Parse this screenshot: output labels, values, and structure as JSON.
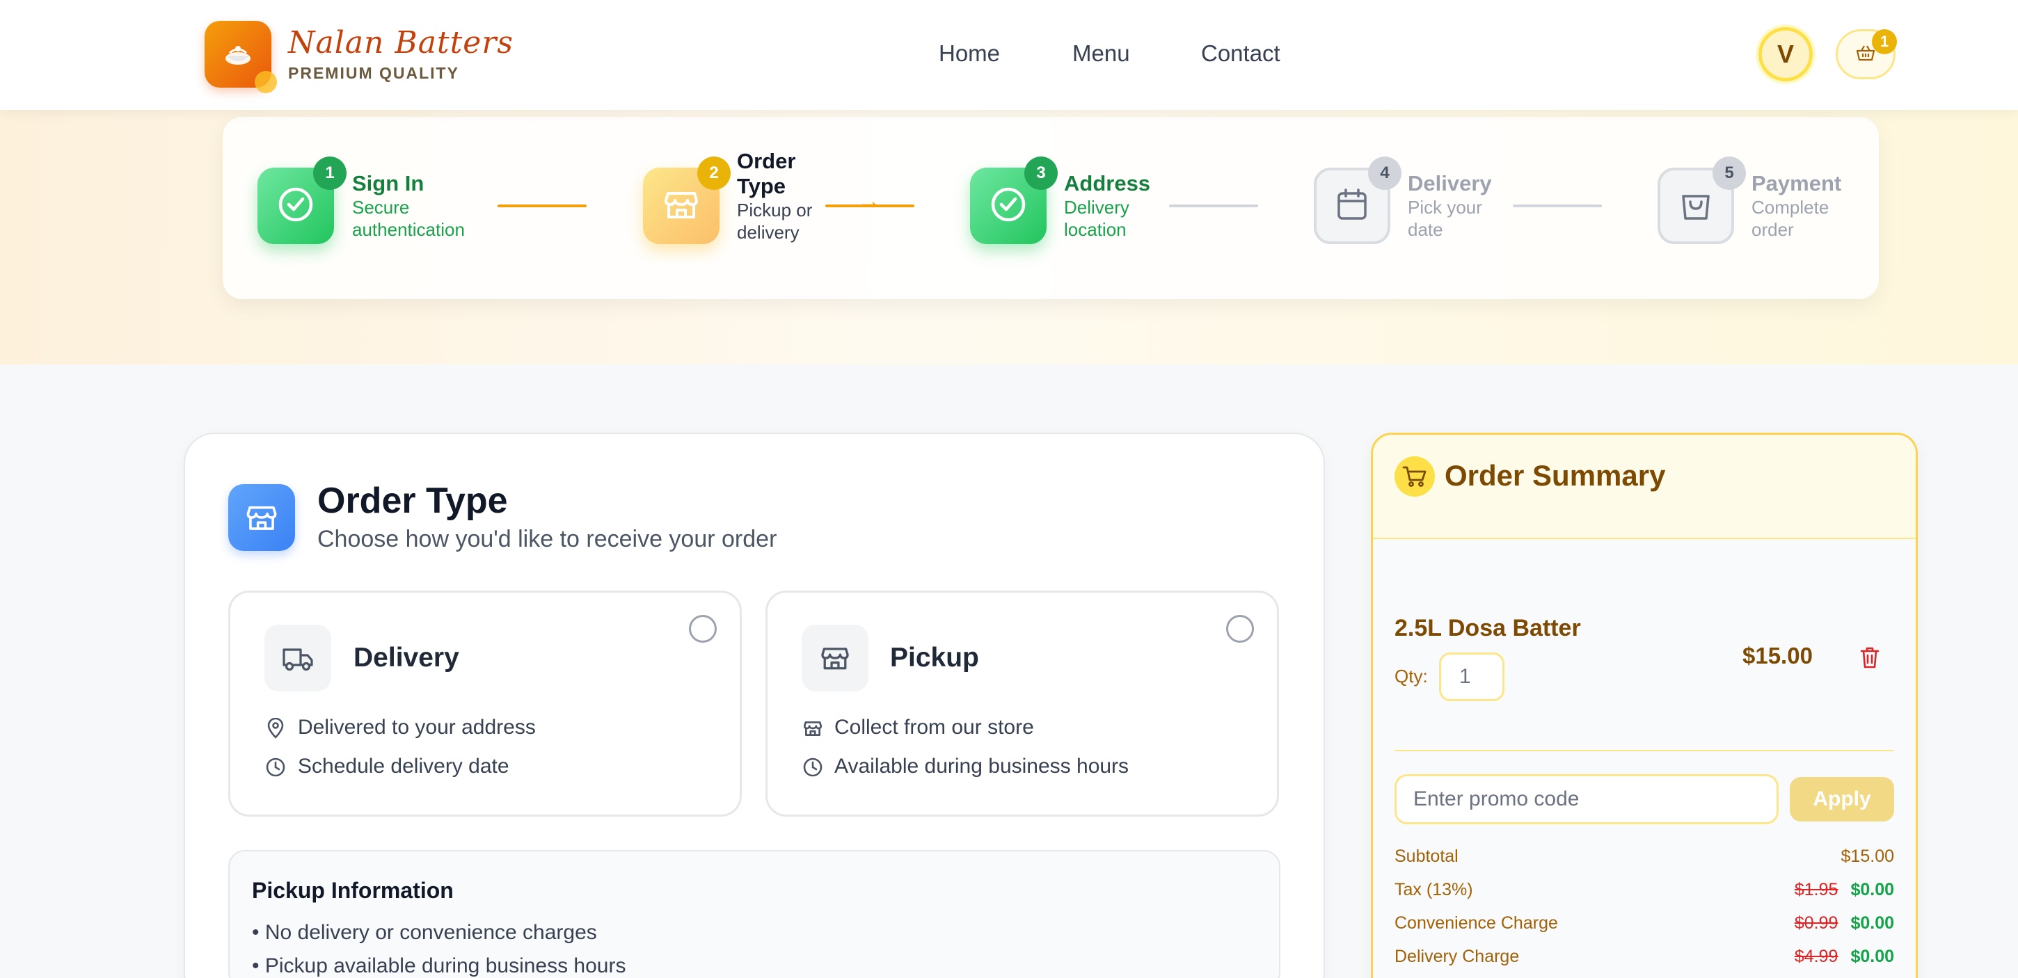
{
  "brand": {
    "name": "Nalan Batters",
    "tagline": "PREMIUM QUALITY"
  },
  "nav": {
    "home": "Home",
    "menu": "Menu",
    "contact": "Contact"
  },
  "user": {
    "initial": "V"
  },
  "cart": {
    "count": "1"
  },
  "steps": [
    {
      "num": "1",
      "title": "Sign In",
      "desc": "Secure authentication",
      "status": "completed",
      "icon": "check-circle-icon"
    },
    {
      "num": "2",
      "title": "Order Type",
      "desc": "Pickup or delivery",
      "status": "active",
      "icon": "store-icon"
    },
    {
      "num": "3",
      "title": "Address",
      "desc": "Delivery location",
      "status": "completed",
      "icon": "check-circle-icon"
    },
    {
      "num": "4",
      "title": "Delivery",
      "desc": "Pick your date",
      "status": "pending",
      "icon": "calendar-icon"
    },
    {
      "num": "5",
      "title": "Payment",
      "desc": "Complete order",
      "status": "pending",
      "icon": "shopping-bag-icon"
    }
  ],
  "order_type": {
    "title": "Order Type",
    "subtitle": "Choose how you'd like to receive your order",
    "options": [
      {
        "title": "Delivery",
        "features": [
          "Delivered to your address",
          "Schedule delivery date"
        ]
      },
      {
        "title": "Pickup",
        "features": [
          "Collect from our store",
          "Available during business hours"
        ]
      }
    ],
    "pickup_info": {
      "title": "Pickup Information",
      "lines": [
        "• No delivery or convenience charges",
        "• Pickup available during business hours"
      ]
    }
  },
  "summary": {
    "title": "Order Summary",
    "item": {
      "name": "2.5L Dosa Batter",
      "qty_label": "Qty:",
      "qty": "1",
      "price": "$15.00"
    },
    "promo_placeholder": "Enter promo code",
    "apply_label": "Apply",
    "rows": [
      {
        "label": "Subtotal",
        "value": "$15.00"
      },
      {
        "label": "Tax (13%)",
        "original": "$1.95",
        "value": "$0.00"
      },
      {
        "label": "Convenience Charge",
        "original": "$0.99",
        "value": "$0.00"
      },
      {
        "label": "Delivery Charge",
        "original": "$4.99",
        "value": "$0.00"
      }
    ]
  },
  "colors": {
    "accent": "#f59e0b",
    "success": "#22c55e",
    "brand": "#c2410c",
    "info": "#3b82f6"
  }
}
